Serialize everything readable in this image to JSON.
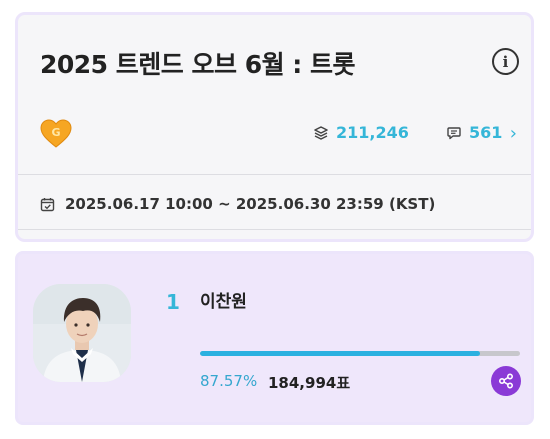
{
  "poll": {
    "title": "2025 트렌드 오브 6월 : 트롯",
    "votes_total": "211,246",
    "comments_count": "561",
    "period": "2025.06.17 10:00 ~ 2025.06.30 23:59 (KST)"
  },
  "ranking": [
    {
      "rank": "1",
      "name": "이찬원",
      "percent": "87.57%",
      "percent_value": 87.57,
      "votes": "184,994표"
    }
  ],
  "icons": {
    "info": "info-icon",
    "heart": "heart-g-badge-icon",
    "votes": "stack-icon",
    "comments": "comment-icon",
    "more": "chevron-right-icon",
    "calendar": "calendar-check-icon",
    "share": "share-icon"
  },
  "colors": {
    "accent": "#35b6d8",
    "share": "#8a3ad6",
    "highlight_bg": "#efe7fb"
  }
}
